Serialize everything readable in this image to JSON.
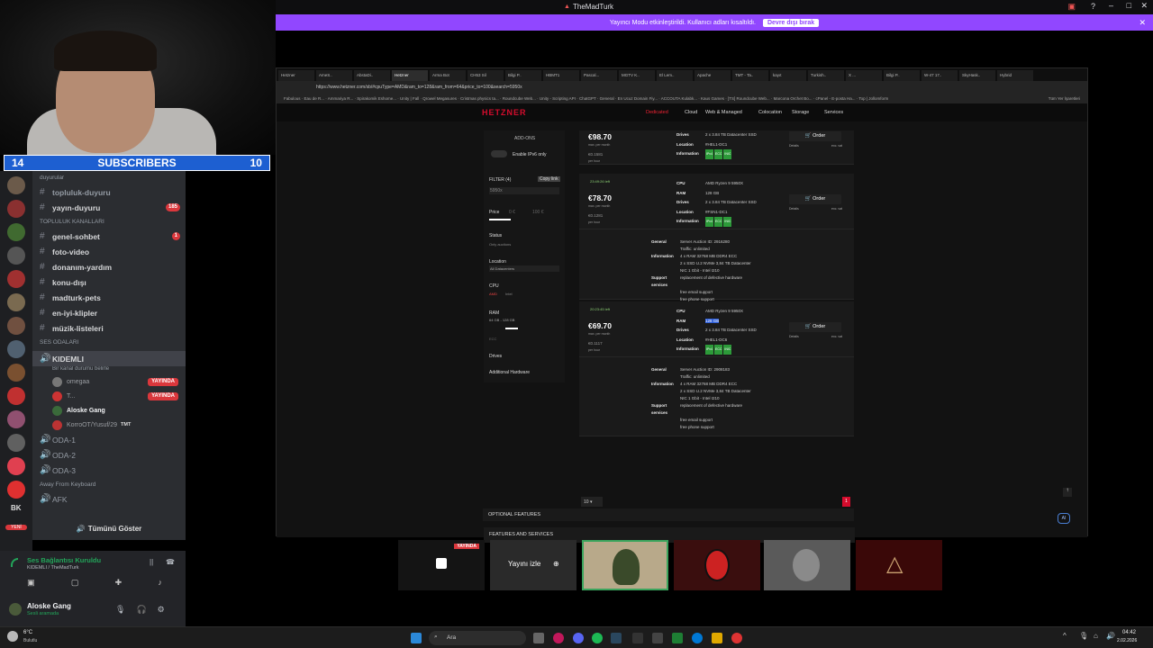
{
  "window": {
    "title": "TheMadTurk"
  },
  "modebar": {
    "message": "Yayıncı Modu etkinleştirildi. Kullanıcı adları kısaltıldı.",
    "button": "Devre dışı bırak"
  },
  "subscribers": {
    "left": "14",
    "label": "SUBSCRIBERS",
    "right": "10"
  },
  "discord": {
    "channels": [
      {
        "type": "cat",
        "label": "duyurular"
      },
      {
        "type": "text",
        "label": "topluluk-duyuru",
        "dim": true
      },
      {
        "type": "text",
        "label": "yayın-duyuru",
        "badge": "185"
      },
      {
        "type": "cat",
        "label": "TOPLULUK KANALLARI"
      },
      {
        "type": "text",
        "label": "genel-sohbet",
        "badge": "1"
      },
      {
        "type": "text",
        "label": "foto-video"
      },
      {
        "type": "text",
        "label": "donanım-yardım"
      },
      {
        "type": "text",
        "label": "konu-dışı"
      },
      {
        "type": "text",
        "label": "madturk-pets"
      },
      {
        "type": "text",
        "label": "en-iyi-klipler"
      },
      {
        "type": "text",
        "label": "müzik-listeleri"
      },
      {
        "type": "cat",
        "label": "SES ODALARI"
      }
    ],
    "voice_channel": {
      "name": "KIDEMLI",
      "sub": "Bir kanal durumu belirle"
    },
    "voice_users": [
      {
        "name": "omegaa",
        "live": "YAYINDA"
      },
      {
        "name": "T...",
        "live": "YAYINDA"
      },
      {
        "name": "Aloske Gang",
        "live": ""
      },
      {
        "name": "KorroOT/Yusuf/29",
        "live": "",
        "tag": "TMT"
      }
    ],
    "rooms": [
      "ODA-1",
      "ODA-2",
      "ODA-3"
    ],
    "afk_cat": "Away From Keyboard",
    "afk": "AFK",
    "show_all": "Tümünü Göster",
    "rail_labels": {
      "bk": "BK",
      "new": "YENİ"
    },
    "connection": {
      "status": "Ses Bağlantısı Kuruldu",
      "channel": "KIDEMLI / TheMadTurk"
    },
    "user": {
      "name": "Aloske Gang",
      "status": "Sesli aramada"
    }
  },
  "browser": {
    "url": "https://www.hetzner.com/sb/#cpuType=AMD&ram_to=128&ram_from=64&price_to=100&search=5950x",
    "tabs": [
      "Hetzner",
      "AmeS..",
      "AbstaDi..",
      "Hetzner",
      "Arma Bot",
      "CH53 Sil",
      "Bilgi P..",
      "HBMT1",
      "Pascal...",
      "MGTV K..",
      "El Lem..",
      "Apache",
      "TMT - Ta..",
      "kayıt",
      "Turkish..",
      "X ...",
      "Bilgi P..",
      "W-47 17..",
      "SkyHask..",
      "Hybrid"
    ],
    "bookmarks": "Fabulous · Eau de R... · Ammariya R... · Spirakomik Eshome... · Unity | Fall · Qrowel Megasures · Cristmas physics ta... · Roundcube Web... · Unity - Scripting API · ChatGPT · General · En Ucuz Domain Fiy... · ACCOUTA Kulabk... · Kaus Games · [TS] Roundcube Web... · Marcona Orchet Bo... · cPanel - E-posta Ha... · Top | Jollomform",
    "bookmarks_right": "Tüm Yer İşaretleri",
    "nav": {
      "logo": "HETZNER",
      "dedicated": "Dedicated",
      "cloud": "Cloud",
      "web": "Web & Managed",
      "colocation": "Colocation",
      "storage": "Storage",
      "services": "Services"
    },
    "filter": {
      "addons": "ADD-ONS",
      "ipv6": "Enable IPv6 only",
      "filter_label": "FILTER (4)",
      "copy": "Copy link",
      "search": "5950x",
      "price": "Price",
      "price_min": "0 €",
      "price_max": "100 €",
      "status": "Status",
      "status_sub": "Only auctions",
      "location": "Location",
      "location_value": "All Datacenters",
      "cpu": "CPU",
      "amd": "AMD",
      "intel": "Intel",
      "ram": "RAM",
      "ram_range": "64 GB - 128 GB",
      "ecc": "ECC",
      "drives": "Drives",
      "additional": "Additional Hardware"
    },
    "servers": [
      {
        "price": "€98.70",
        "per": "max. per month",
        "hour": "€0.1581",
        "hour_label": "per hour",
        "timer": "",
        "cpu": "",
        "ram": "",
        "drives": "2 x 3.84 TB Datacenter SSD",
        "location": "#HEL1-DC1",
        "order": "Order",
        "details": "Details",
        "vat": "exc. vat"
      },
      {
        "price": "€78.70",
        "per": "max. per month",
        "hour": "€0.1281",
        "hour_label": "per hour",
        "timer": "23:49:26 left",
        "cpu": "AMD Ryzen 9 5950X",
        "ram": "128 GB",
        "drives": "2 x 3.84 TB Datacenter SSD",
        "location": "#FSN1-DC1",
        "order": "Order",
        "details": "Details",
        "vat": "exc. vat",
        "general": "Server Auction ID: 2916280",
        "traffic": "Traffic: unlimited",
        "info": [
          "4 x RAM 32768 MB DDR4 ECC",
          "2 x SSD U.2 NVMe 3,84 TB Datacenter",
          "NIC 1 Gbit - Intel I210"
        ],
        "support": [
          "replacement of defective hardware",
          "free email support",
          "free phone support"
        ]
      },
      {
        "price": "€69.70",
        "per": "max. per month",
        "hour": "€0.1117",
        "hour_label": "per hour",
        "timer": "20:23:45 left",
        "cpu": "AMD Ryzen 9 5950X",
        "ram": "128 GB",
        "drives": "2 x 3.84 TB Datacenter SSD",
        "location": "#HEL1-DC6",
        "order": "Order",
        "details": "Details",
        "vat": "exc. vat",
        "general": "Server Auction ID: 2908183",
        "traffic": "Traffic: unlimited",
        "info": [
          "4 x RAM 32768 MB DDR4 ECC",
          "2 x SSD U.2 NVMe 3,84 TB Datacenter",
          "NIC 1 Gbit - Intel I210"
        ],
        "support": [
          "replacement of defective hardware",
          "free email support",
          "free phone support"
        ]
      }
    ],
    "labels": {
      "cpu": "CPU",
      "ram": "RAM",
      "drives": "Drives",
      "location": "Location",
      "information": "Information",
      "general": "General",
      "support": "Support services"
    },
    "tags": [
      "IPv4",
      "ECC",
      "INIC"
    ],
    "per_page": "10",
    "page": "1",
    "features": "FEATURES AND SERVICES",
    "optional": "OPTIONAL FEATURES",
    "ai": "AI"
  },
  "thumbs": {
    "live": "YAYINDA",
    "watch": "Yayını izle"
  },
  "taskbar": {
    "weather_temp": "6°C",
    "weather_text": "Bulutlu",
    "search": "Ara",
    "time": "04:42",
    "date": "2.02.2026"
  },
  "colors": {
    "twitch": "#9147ff",
    "hetzner": "#d50c2d",
    "sub_blue": "#1d5fd1",
    "discord_bg": "#2b2d31"
  }
}
